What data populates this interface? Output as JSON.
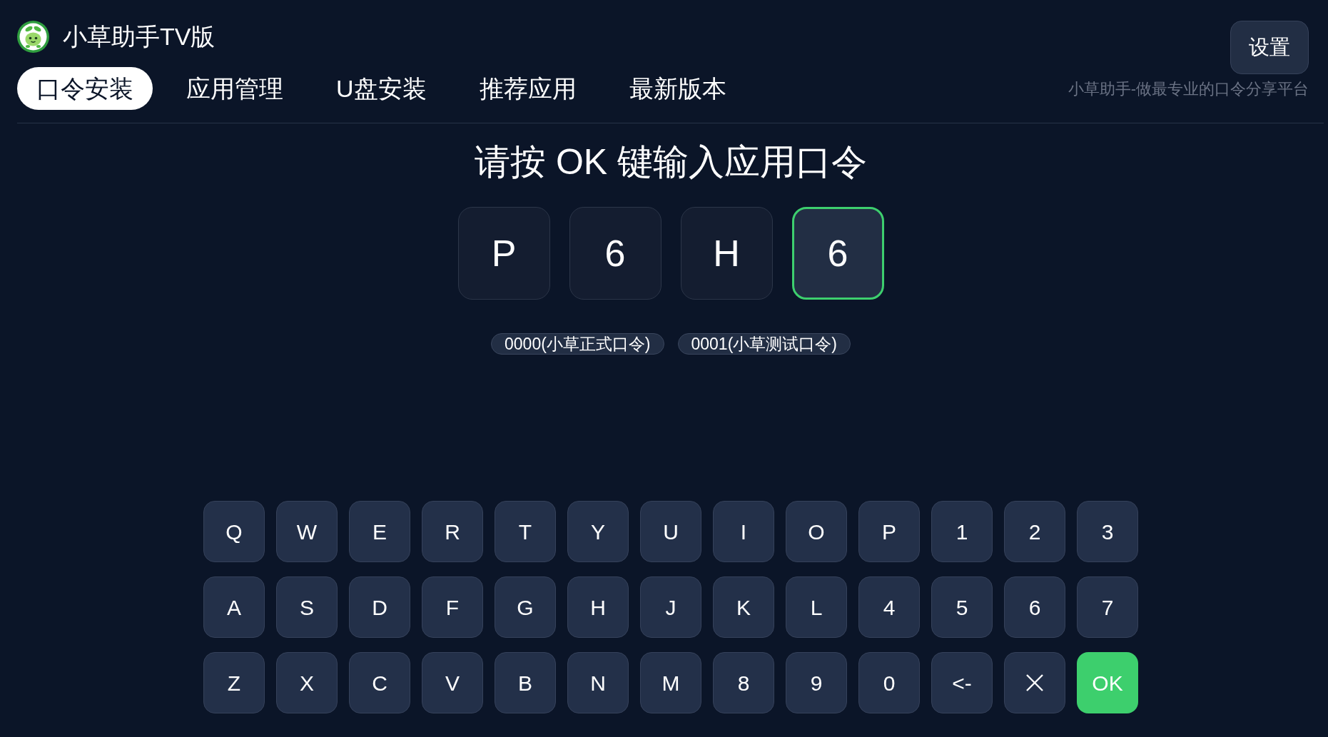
{
  "app": {
    "title": "小草助手TV版"
  },
  "tabs": [
    {
      "label": "口令安装",
      "selected": true
    },
    {
      "label": "应用管理",
      "selected": false
    },
    {
      "label": "U盘安装",
      "selected": false
    },
    {
      "label": "推荐应用",
      "selected": false
    },
    {
      "label": "最新版本",
      "selected": false
    }
  ],
  "settings_button": {
    "label": "设置"
  },
  "tagline": "小草助手-做最专业的口令分享平台",
  "prompt": "请按 OK 键输入应用口令",
  "code_boxes": [
    {
      "char": "P",
      "selected": false
    },
    {
      "char": "6",
      "selected": false
    },
    {
      "char": "H",
      "selected": false
    },
    {
      "char": "6",
      "selected": true
    }
  ],
  "hint_chips": [
    "0000(小草正式口令)",
    "0001(小草测试口令)"
  ],
  "keyboard": {
    "rows": [
      [
        {
          "kind": "char",
          "label": "Q"
        },
        {
          "kind": "char",
          "label": "W"
        },
        {
          "kind": "char",
          "label": "E"
        },
        {
          "kind": "char",
          "label": "R"
        },
        {
          "kind": "char",
          "label": "T"
        },
        {
          "kind": "char",
          "label": "Y"
        },
        {
          "kind": "char",
          "label": "U"
        },
        {
          "kind": "char",
          "label": "I"
        },
        {
          "kind": "char",
          "label": "O"
        },
        {
          "kind": "char",
          "label": "P"
        },
        {
          "kind": "char",
          "label": "1"
        },
        {
          "kind": "char",
          "label": "2"
        },
        {
          "kind": "char",
          "label": "3"
        }
      ],
      [
        {
          "kind": "char",
          "label": "A"
        },
        {
          "kind": "char",
          "label": "S"
        },
        {
          "kind": "char",
          "label": "D"
        },
        {
          "kind": "char",
          "label": "F"
        },
        {
          "kind": "char",
          "label": "G"
        },
        {
          "kind": "char",
          "label": "H"
        },
        {
          "kind": "char",
          "label": "J"
        },
        {
          "kind": "char",
          "label": "K"
        },
        {
          "kind": "char",
          "label": "L"
        },
        {
          "kind": "char",
          "label": "4"
        },
        {
          "kind": "char",
          "label": "5"
        },
        {
          "kind": "char",
          "label": "6"
        },
        {
          "kind": "char",
          "label": "7"
        }
      ],
      [
        {
          "kind": "char",
          "label": "Z"
        },
        {
          "kind": "char",
          "label": "X"
        },
        {
          "kind": "char",
          "label": "C"
        },
        {
          "kind": "char",
          "label": "V"
        },
        {
          "kind": "char",
          "label": "B"
        },
        {
          "kind": "char",
          "label": "N"
        },
        {
          "kind": "char",
          "label": "M"
        },
        {
          "kind": "char",
          "label": "8"
        },
        {
          "kind": "char",
          "label": "9"
        },
        {
          "kind": "char",
          "label": "0"
        },
        {
          "kind": "char",
          "label": "<-"
        },
        {
          "kind": "clear"
        },
        {
          "kind": "confirm",
          "label": "OK"
        }
      ]
    ]
  }
}
